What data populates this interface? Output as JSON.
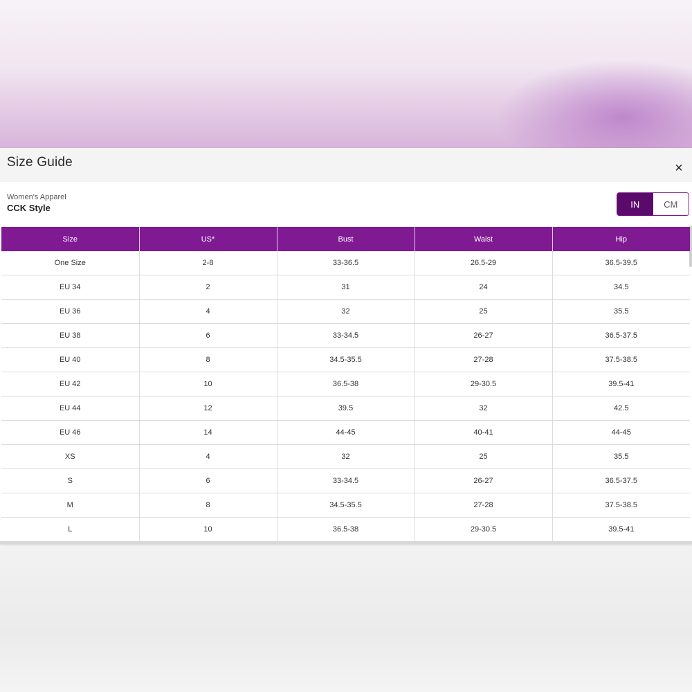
{
  "modal": {
    "title": "Size Guide",
    "close_symbol": "×",
    "category": "Women's Apparel",
    "style_name": "CCK Style"
  },
  "unit_toggle": {
    "options": [
      "IN",
      "CM"
    ],
    "selected": "IN",
    "accent_color": "#5a0a6b"
  },
  "table": {
    "header_color": "#7f1a93",
    "columns": [
      "Size",
      "US*",
      "Bust",
      "Waist",
      "Hip"
    ],
    "rows": [
      [
        "One Size",
        "2-8",
        "33-36.5",
        "26.5-29",
        "36.5-39.5"
      ],
      [
        "EU 34",
        "2",
        "31",
        "24",
        "34.5"
      ],
      [
        "EU 36",
        "4",
        "32",
        "25",
        "35.5"
      ],
      [
        "EU 38",
        "6",
        "33-34.5",
        "26-27",
        "36.5-37.5"
      ],
      [
        "EU 40",
        "8",
        "34.5-35.5",
        "27-28",
        "37.5-38.5"
      ],
      [
        "EU 42",
        "10",
        "36.5-38",
        "29-30.5",
        "39.5-41"
      ],
      [
        "EU 44",
        "12",
        "39.5",
        "32",
        "42.5"
      ],
      [
        "EU 46",
        "14",
        "44-45",
        "40-41",
        "44-45"
      ],
      [
        "XS",
        "4",
        "32",
        "25",
        "35.5"
      ],
      [
        "S",
        "6",
        "33-34.5",
        "26-27",
        "36.5-37.5"
      ],
      [
        "M",
        "8",
        "34.5-35.5",
        "27-28",
        "37.5-38.5"
      ],
      [
        "L",
        "10",
        "36.5-38",
        "29-30.5",
        "39.5-41"
      ]
    ]
  }
}
